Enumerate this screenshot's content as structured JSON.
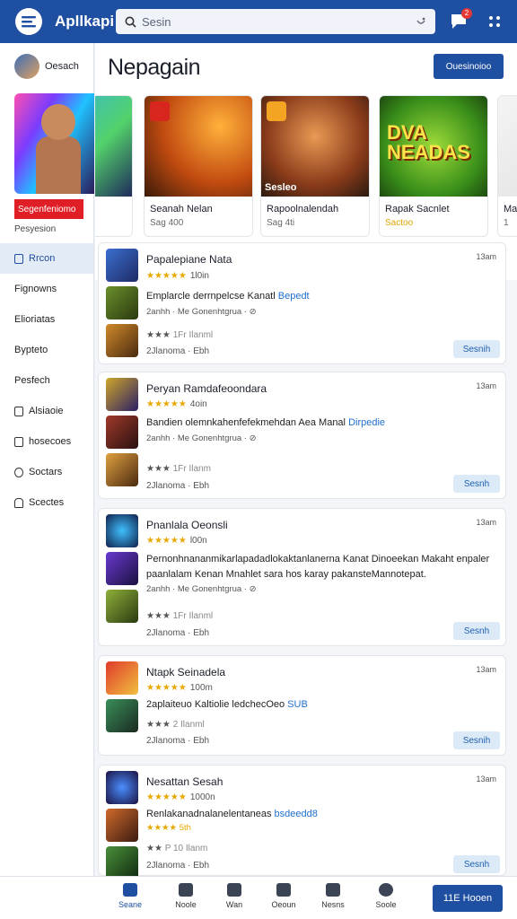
{
  "header": {
    "app_title": "Apllkapi",
    "search_placeholder": "Sesin",
    "notification_count": "2"
  },
  "sidebar": {
    "user_name": "Oesach",
    "promo_button": "Segenfeniomo",
    "promo_sub": "Pesyesion",
    "items": [
      {
        "label": "Rrcon",
        "icon": "square-icon",
        "active": true
      },
      {
        "label": "Fignowns",
        "icon": "none"
      },
      {
        "label": "Elioriatas",
        "icon": "none"
      },
      {
        "label": "Bypteto",
        "icon": "none"
      },
      {
        "label": "Pesfech",
        "icon": "none"
      },
      {
        "label": "Alsiaoie",
        "icon": "clipboard-icon"
      },
      {
        "label": "hosecoes",
        "icon": "document-icon"
      },
      {
        "label": "Soctars",
        "icon": "gear-icon"
      },
      {
        "label": "Scectes",
        "icon": "home-icon"
      }
    ]
  },
  "main": {
    "page_title": "Nepagain",
    "header_button": "Ouesinoioo",
    "carousel": [
      {
        "title": "Seanah Nelan",
        "sub": "Sag 400"
      },
      {
        "title": "Rapoolnalendah",
        "sub": "Sag 4ti",
        "overlay": "Sesleo"
      },
      {
        "title": "Rapak Sacnlet",
        "sub": "Sactoo",
        "big_label": "DVA NEADAS"
      },
      {
        "title": "Ma",
        "sub": "1"
      }
    ],
    "list": [
      {
        "title": "Papalepiane Nata",
        "time": "13am",
        "stars": "★★★★★",
        "stars_meta": "1l0in",
        "desc": "Emplarcle derrnpelcse Kanatl",
        "desc_link": "Bepedt",
        "sub": "2anhh · Me  Gonenhtgrua  ·  ⊘",
        "rate2_stars": "★★★",
        "rate2_meta": "1Fr Ilanml",
        "foot": "2Jlanoma  ·  Ebh",
        "action": "Sesnih"
      },
      {
        "title": "Peryan Ramdafeoondara",
        "time": "13am",
        "stars": "★★★★★",
        "stars_meta": "4oin",
        "desc": "Bandien olemnkahenfefekmehdan Aea Manal",
        "desc_link": "Dirpedie",
        "sub": "2anhh · Me  Gonenhtgrua  ·  ⊘",
        "rate2_stars": "★★★",
        "rate2_meta": "1Fr Ilanm",
        "foot": "2Jlanoma  ·  Ebh",
        "action": "Sesnh"
      },
      {
        "title": "Pnanlala Oeonsli",
        "time": "13am",
        "stars": "★★★★★",
        "stars_meta": "l00n",
        "desc": "Pernonhnananmikarlapadadlokaktanlanerna Kanat Dinoeekan Makaht enpaler paanlalam Kenan Mnahlet sara hos karay pakansteMannotepat.",
        "desc_link": "",
        "sub": "2anhh · Me  Gonenhtgrua  ·  ⊘",
        "rate2_stars": "★★★",
        "rate2_meta": "1Fr Ilanml",
        "foot": "2Jlanoma  ·  Ebh",
        "action": "Sesnh"
      },
      {
        "title": "Ntapk Seinadela",
        "time": "13am",
        "stars": "★★★★★",
        "stars_meta": "100m",
        "desc": "2aplaiteuo Kaltiolie ledchecOeo",
        "desc_link": "SUB",
        "sub": "",
        "rate2_stars": "★★★",
        "rate2_meta": "2 Ilanml",
        "foot": "2Jlanoma  ·  Ebh",
        "action": "Sesnih"
      },
      {
        "title": "Nesattan Sesah",
        "time": "13am",
        "stars": "★★★★★",
        "stars_meta": "1000n",
        "desc": "Renlakanadnalanelentaneas",
        "desc_link": "bsdeedd8",
        "sub": "★★★★ 5th",
        "rate2_stars": "★★",
        "rate2_meta": "P 10 Ilanm",
        "foot": "2Jlanoma  ·  Ebh",
        "action": "Sesnh"
      }
    ]
  },
  "bottom_nav": {
    "items": [
      "Seane",
      "Noole",
      "Wan",
      "Oeoun",
      "Nesns",
      "Soole"
    ],
    "cta": "11E Hooen"
  },
  "colors": {
    "primary": "#1f4fa0",
    "danger": "#e01e25",
    "star": "#e8a800",
    "link": "#1f6fd0"
  }
}
